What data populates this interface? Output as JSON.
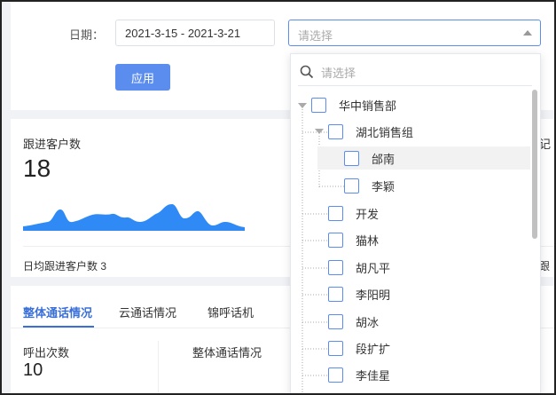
{
  "filter": {
    "date_label": "日期：",
    "date_range": "2021-3-15 - 2021-3-21",
    "select_placeholder": "请选择",
    "apply_label": "应用"
  },
  "stats": {
    "title": "跟进客户数",
    "value": "18",
    "footer": "日均跟进客户数 3",
    "right_title_partial": "记",
    "right_footer_partial": "跟",
    "sparkline_color": "#2f8af5"
  },
  "calls": {
    "tabs": [
      {
        "label": "整体通话情况",
        "active": true
      },
      {
        "label": "云通话情况",
        "active": false
      },
      {
        "label": "锦呼话机",
        "active": false
      }
    ],
    "metric_label": "呼出次数",
    "metric_value": "10",
    "sub_title": "整体通话情况"
  },
  "dropdown": {
    "search_placeholder": "请选择",
    "nodes": [
      {
        "label": "华中销售部",
        "level": 0,
        "expanded": true
      },
      {
        "label": "湖北销售组",
        "level": 1,
        "expanded": true
      },
      {
        "label": "邰南",
        "level": 2,
        "highlighted": true
      },
      {
        "label": "李颖",
        "level": 2
      },
      {
        "label": "开发",
        "level": 1
      },
      {
        "label": "猫林",
        "level": 1
      },
      {
        "label": "胡凡平",
        "level": 1
      },
      {
        "label": "李阳明",
        "level": 1
      },
      {
        "label": "胡冰",
        "level": 1
      },
      {
        "label": "段扩扩",
        "level": 1
      },
      {
        "label": "李佳星",
        "level": 1
      }
    ]
  },
  "colors": {
    "accent": "#5b8def",
    "tab_active": "#3a6fd8"
  }
}
